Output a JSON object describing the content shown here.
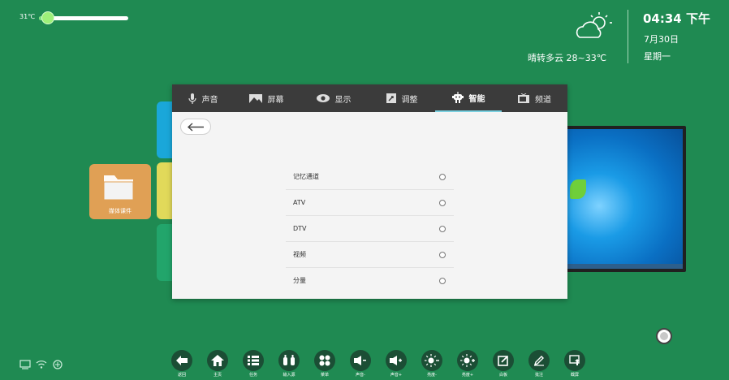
{
  "temperature": {
    "label": "31℃",
    "level_percent": 10
  },
  "weather": {
    "description": "晴转多云  28~33℃",
    "icon": "partly-cloudy-icon"
  },
  "clock": {
    "time": "04:34 下午",
    "date": "7月30日",
    "weekday": "星期一"
  },
  "desktop": {
    "media_tile_label": "媒体课件"
  },
  "settings": {
    "tabs": [
      {
        "label": "声音",
        "icon": "microphone-icon"
      },
      {
        "label": "屏幕",
        "icon": "screen-icon"
      },
      {
        "label": "显示",
        "icon": "eye-icon"
      },
      {
        "label": "调整",
        "icon": "adjust-icon"
      },
      {
        "label": "智能",
        "icon": "robot-icon",
        "active": true
      },
      {
        "label": "频道",
        "icon": "tv-icon"
      }
    ],
    "options": [
      {
        "label": "记忆通道"
      },
      {
        "label": "ATV"
      },
      {
        "label": "DTV"
      },
      {
        "label": "视频"
      },
      {
        "label": "分量"
      }
    ]
  },
  "dock": [
    {
      "label": "返回",
      "icon": "back-arrow-icon"
    },
    {
      "label": "主页",
      "icon": "home-icon"
    },
    {
      "label": "任务",
      "icon": "task-list-icon"
    },
    {
      "label": "输入源",
      "icon": "input-source-icon"
    },
    {
      "label": "菜单",
      "icon": "menu-icon"
    },
    {
      "label": "声音-",
      "icon": "volume-down-icon"
    },
    {
      "label": "声音+",
      "icon": "volume-up-icon"
    },
    {
      "label": "亮度-",
      "icon": "brightness-down-icon"
    },
    {
      "label": "亮度+",
      "icon": "brightness-up-icon"
    },
    {
      "label": "白板",
      "icon": "whiteboard-icon"
    },
    {
      "label": "批注",
      "icon": "annotate-icon"
    },
    {
      "label": "截屏",
      "icon": "screenshot-icon"
    }
  ],
  "colors": {
    "background": "#1f8a52",
    "tab_bar": "#3b3b3b",
    "active_tab_underline": "#7ad0e0",
    "media_tile": "#e0a055"
  }
}
